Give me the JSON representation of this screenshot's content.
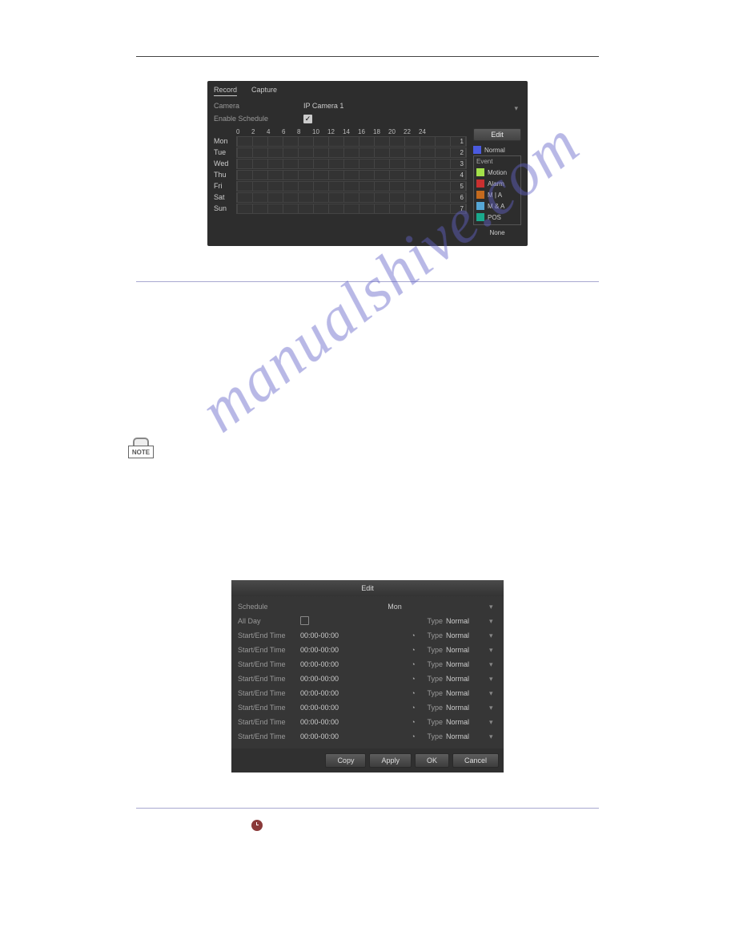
{
  "watermark": "manualshive.com",
  "panel1": {
    "tabs": {
      "record": "Record",
      "capture": "Capture"
    },
    "camera_label": "Camera",
    "camera_value": "IP Camera 1",
    "enable_label": "Enable Schedule",
    "enable_checked": true,
    "hours": [
      "0",
      "2",
      "4",
      "6",
      "8",
      "10",
      "12",
      "14",
      "16",
      "18",
      "20",
      "22",
      "24"
    ],
    "days": [
      {
        "label": "Mon",
        "num": "1"
      },
      {
        "label": "Tue",
        "num": "2"
      },
      {
        "label": "Wed",
        "num": "3"
      },
      {
        "label": "Thu",
        "num": "4"
      },
      {
        "label": "Fri",
        "num": "5"
      },
      {
        "label": "Sat",
        "num": "6"
      },
      {
        "label": "Sun",
        "num": "7"
      }
    ],
    "edit_btn": "Edit",
    "legend": {
      "normal": "Normal",
      "group_title": "Event",
      "motion": "Motion",
      "alarm": "Alarm",
      "mia": "M | A",
      "maa": "M & A",
      "pos": "POS",
      "none": "None"
    },
    "colors": {
      "normal": "#4a5adf",
      "motion": "#a3e04a",
      "alarm": "#c93030",
      "mia": "#c46a1e",
      "maa": "#56a7d6",
      "pos": "#1aa98c"
    }
  },
  "note_label": "NOTE",
  "panel2": {
    "title": "Edit",
    "schedule_label": "Schedule",
    "schedule_value": "Mon",
    "allday_label": "All Day",
    "type_label": "Type",
    "type_value": "Normal",
    "rows": [
      {
        "label": "Start/End Time",
        "time": "00:00-00:00",
        "type": "Normal"
      },
      {
        "label": "Start/End Time",
        "time": "00:00-00:00",
        "type": "Normal"
      },
      {
        "label": "Start/End Time",
        "time": "00:00-00:00",
        "type": "Normal"
      },
      {
        "label": "Start/End Time",
        "time": "00:00-00:00",
        "type": "Normal"
      },
      {
        "label": "Start/End Time",
        "time": "00:00-00:00",
        "type": "Normal"
      },
      {
        "label": "Start/End Time",
        "time": "00:00-00:00",
        "type": "Normal"
      },
      {
        "label": "Start/End Time",
        "time": "00:00-00:00",
        "type": "Normal"
      },
      {
        "label": "Start/End Time",
        "time": "00:00-00:00",
        "type": "Normal"
      }
    ],
    "buttons": {
      "copy": "Copy",
      "apply": "Apply",
      "ok": "OK",
      "cancel": "Cancel"
    }
  }
}
